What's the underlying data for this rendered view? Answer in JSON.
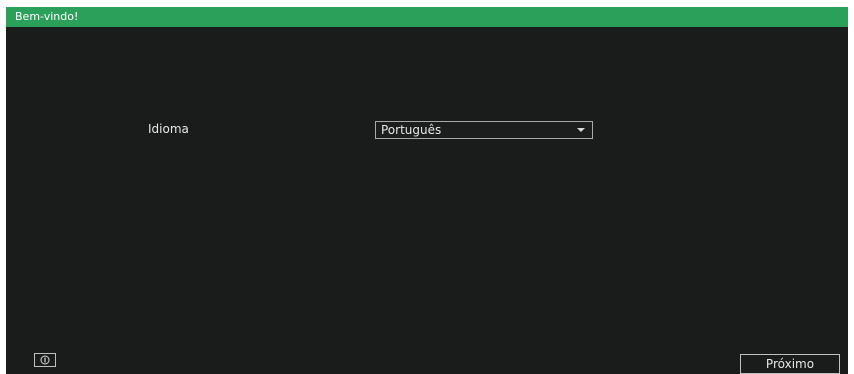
{
  "window": {
    "title": "Bem-vindo!"
  },
  "language": {
    "label": "Idioma",
    "selected": "Português"
  },
  "footer": {
    "info_icon": "info-icon",
    "next_label": "Próximo"
  },
  "colors": {
    "titlebar": "#2aa05a",
    "background": "#1a1c1b"
  }
}
